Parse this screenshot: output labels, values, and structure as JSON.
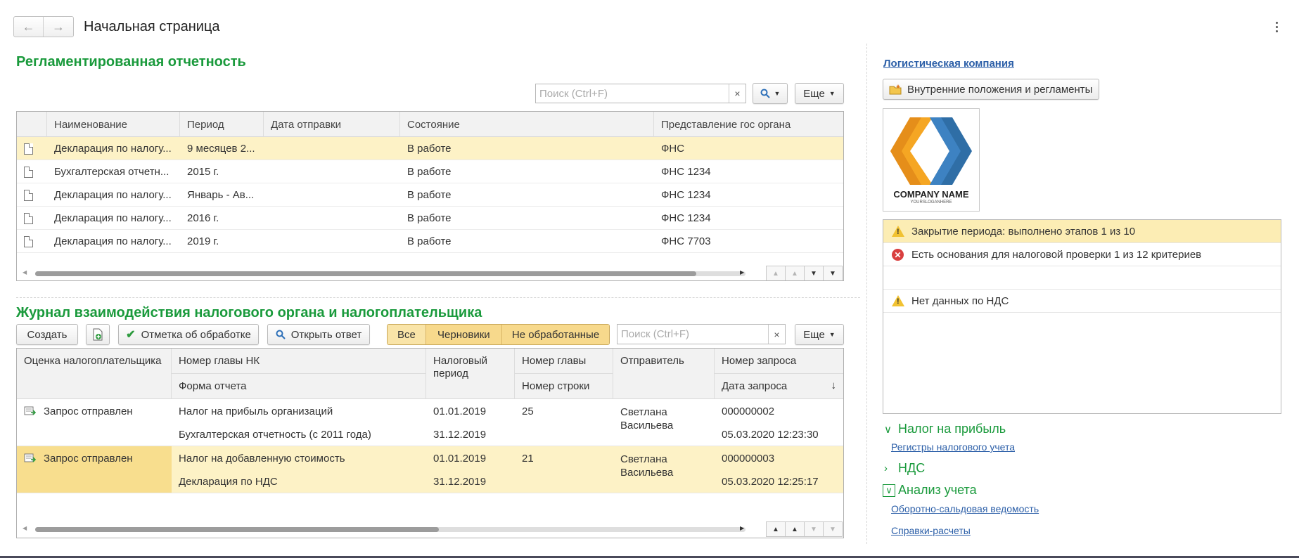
{
  "window": {
    "title": "Начальная страница",
    "back_icon": "arrow-left-icon",
    "forward_icon": "arrow-right-icon",
    "menu_icon": "more-vertical-icon"
  },
  "reports": {
    "title": "Регламентированная отчетность",
    "search_placeholder": "Поиск (Ctrl+F)",
    "search_clear": "×",
    "more_label": "Еще",
    "columns": [
      "Наименование",
      "Период",
      "Дата отправки",
      "Состояние",
      "Представление гос органа"
    ],
    "rows": [
      {
        "name": "Декларация по налогу...",
        "period": "9 месяцев 2...",
        "sent": "",
        "state": "В работе",
        "org": "ФНС",
        "selected": true
      },
      {
        "name": "Бухгалтерская отчетн...",
        "period": "2015 г.",
        "sent": "",
        "state": "В работе",
        "org": "ФНС 1234",
        "selected": false
      },
      {
        "name": "Декларация по налогу...",
        "period": "Январь - Ав...",
        "sent": "",
        "state": "В работе",
        "org": "ФНС 1234",
        "selected": false
      },
      {
        "name": "Декларация по налогу...",
        "period": "2016 г.",
        "sent": "",
        "state": "В работе",
        "org": "ФНС 1234",
        "selected": false
      },
      {
        "name": "Декларация по налогу...",
        "period": "2019 г.",
        "sent": "",
        "state": "В работе",
        "org": "ФНС 7703",
        "selected": false
      }
    ]
  },
  "journal": {
    "title": "Журнал взаимодействия налогового органа и налогоплательщика",
    "create_label": "Создать",
    "mark_label": "Отметка об обработке",
    "open_answer_label": "Открыть ответ",
    "filters": [
      "Все",
      "Черновики",
      "Не обработанные"
    ],
    "search_placeholder": "Поиск (Ctrl+F)",
    "search_clear": "×",
    "more_label": "Еще",
    "columns": {
      "rating": "Оценка налогоплательщика",
      "chapter": "Номер главы НК",
      "form": "Форма отчета",
      "period": "Налоговый период",
      "chapter_no": "Номер главы",
      "line_no": "Номер строки",
      "sender": "Отправитель",
      "request_no": "Номер запроса",
      "request_date": "Дата запроса",
      "sort_arrow": "↓"
    },
    "rows": [
      {
        "status": "Запрос отправлен",
        "tax": "Налог на прибыль организаций",
        "form": "Бухгалтерская отчетность (с 2011 года)",
        "period_from": "01.01.2019",
        "period_to": "31.12.2019",
        "chapter": "25",
        "sender": "Светлана Васильева",
        "req_no": "000000002",
        "req_date": "05.03.2020 12:23:30",
        "selected": false
      },
      {
        "status": "Запрос отправлен",
        "tax": "Налог на добавленную стоимость",
        "form": "Декларация по НДС",
        "period_from": "01.01.2019",
        "period_to": "31.12.2019",
        "chapter": "21",
        "sender": "Светлана Васильева",
        "req_no": "000000003",
        "req_date": "05.03.2020 12:25:17",
        "selected": true
      }
    ]
  },
  "sidebar": {
    "company_link": "Логистическая компания",
    "regulations_button": "Внутренние положения и регламенты",
    "logo_name": "COMPANY NAME",
    "logo_slogan": "YOURSLOGANHERE",
    "logo_colors": {
      "orange": "#f5a623",
      "blue": "#2f6ea6"
    },
    "notices": [
      {
        "type": "warning",
        "text": "Закрытие периода: выполнено этапов 1 из 10",
        "selected": true
      },
      {
        "type": "error",
        "text": "Есть основания для налоговой проверки 1 из 12 критериев",
        "selected": false
      },
      {
        "type": "empty",
        "text": "",
        "selected": false
      },
      {
        "type": "warning",
        "text": "Нет данных по НДС",
        "selected": false
      }
    ],
    "sections": [
      {
        "title": "Налог на прибыль",
        "expanded": true,
        "links": [
          "Регистры налогового учета"
        ]
      },
      {
        "title": "НДС",
        "expanded": false,
        "links": []
      },
      {
        "title": "Анализ учета",
        "expanded": true,
        "links": [
          "Оборотно-сальдовая ведомость",
          "Справки-расчеты"
        ]
      }
    ]
  },
  "colors": {
    "accent_green": "#1a9a3c",
    "selected_row": "#fdf2c6",
    "link_blue": "#2c5fa8"
  }
}
